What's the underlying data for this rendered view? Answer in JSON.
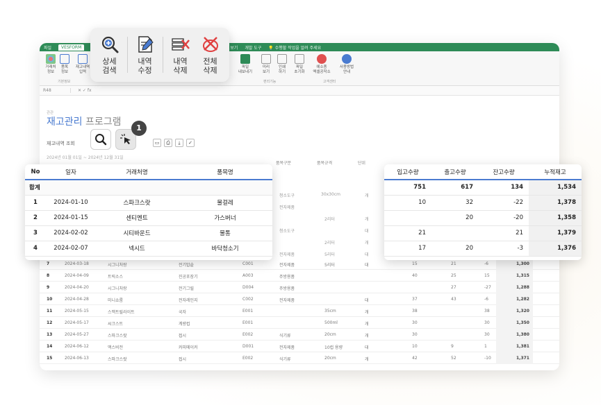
{
  "ribbon": {
    "tabs": [
      "파일",
      "VESFORM",
      "보기",
      "개발 도구",
      "수행할 작업을 알려 주세요"
    ],
    "buttons": [
      {
        "label": "거래처\n정보"
      },
      {
        "label": "품목\n정보"
      },
      {
        "label": "재고내역\n입력"
      },
      {
        "label": "파일\n내보내기"
      },
      {
        "label": "미리\n보기"
      },
      {
        "label": "인쇄\n하기"
      },
      {
        "label": "파일\n초기화"
      },
      {
        "label": "에소종\n엑셀공작소"
      },
      {
        "label": "사용방법\n안내"
      }
    ],
    "groups": [
      "기본정보",
      "편리기능",
      "고객센터"
    ]
  },
  "formula": {
    "cell_ref": "R48"
  },
  "toolbar": {
    "detail_search": "상세\n검색",
    "edit_record": "내역\n수정",
    "delete_record": "내역\n삭제",
    "delete_all": "전체\n삭제"
  },
  "program": {
    "breadcrumb": "관관",
    "title_a": "재고관리",
    "title_b": " 프로그램",
    "subtitle": "재고내역 조회",
    "date_range": "2024년 01월 01일 ~ 2024년 12월 31일"
  },
  "badge": "1",
  "left_table": {
    "headers": {
      "no": "No",
      "date": "일자",
      "vendor": "거래처명",
      "item": "품목명"
    },
    "total_label": "합계",
    "rows": [
      {
        "no": "1",
        "date": "2024-01-10",
        "vendor": "스파크스랏",
        "item": "물걸레"
      },
      {
        "no": "2",
        "date": "2024-01-15",
        "vendor": "센티멘트",
        "item": "가스버너"
      },
      {
        "no": "3",
        "date": "2024-02-02",
        "vendor": "시티바운드",
        "item": "물통"
      },
      {
        "no": "4",
        "date": "2024-02-07",
        "vendor": "넥시드",
        "item": "바닥청소기"
      }
    ]
  },
  "right_table": {
    "headers": {
      "in": "입고수량",
      "out": "출고수량",
      "remain": "잔고수량",
      "stock": "누적재고"
    },
    "total": {
      "in": "751",
      "out": "617",
      "remain": "134",
      "stock": "1,534"
    },
    "rows": [
      {
        "in": "10",
        "out": "32",
        "remain": "-22",
        "stock": "1,378"
      },
      {
        "in": "",
        "out": "20",
        "remain": "-20",
        "stock": "1,358"
      },
      {
        "in": "21",
        "out": "",
        "remain": "21",
        "stock": "1,379"
      },
      {
        "in": "17",
        "out": "20",
        "remain": "-3",
        "stock": "1,376"
      }
    ]
  },
  "bg_headers": {
    "category": "품목구분",
    "spec": "품목규격",
    "unit": "단위"
  },
  "bg_rows": [
    {
      "no": "7",
      "date": "2024-03-18",
      "vendor": "시그니처랑",
      "item": "전기밥솥",
      "code": "C001",
      "cat": "전자제품",
      "spec": "5리터",
      "unit": "대",
      "in": "15",
      "out": "21",
      "remain": "-6",
      "stock": "1,300"
    },
    {
      "no": "8",
      "date": "2024-04-09",
      "vendor": "트릭소스",
      "item": "진공포장기",
      "code": "A003",
      "cat": "주방용품",
      "spec": "",
      "unit": "",
      "in": "40",
      "out": "25",
      "remain": "15",
      "stock": "1,315"
    },
    {
      "no": "9",
      "date": "2024-04-20",
      "vendor": "시그니처랑",
      "item": "전기그릴",
      "code": "D004",
      "cat": "주방용품",
      "spec": "",
      "unit": "",
      "in": "",
      "out": "27",
      "remain": "-27",
      "stock": "1,288"
    },
    {
      "no": "10",
      "date": "2024-04-28",
      "vendor": "미니쇼룸",
      "item": "전자레인지",
      "code": "C002",
      "cat": "전자제품",
      "spec": "",
      "unit": "대",
      "in": "37",
      "out": "43",
      "remain": "-6",
      "stock": "1,282"
    },
    {
      "no": "11",
      "date": "2024-05-15",
      "vendor": "스맥트릴라이트",
      "item": "국자",
      "code": "E001",
      "cat": "",
      "spec": "35cm",
      "unit": "개",
      "in": "38",
      "out": "",
      "remain": "38",
      "stock": "1,320"
    },
    {
      "no": "12",
      "date": "2024-05-17",
      "vendor": "씨크스트",
      "item": "계량컵",
      "code": "E001",
      "cat": "",
      "spec": "500ml",
      "unit": "개",
      "in": "30",
      "out": "",
      "remain": "30",
      "stock": "1,350"
    },
    {
      "no": "13",
      "date": "2024-05-27",
      "vendor": "스파크스랏",
      "item": "접시",
      "code": "E002",
      "cat": "식기류",
      "spec": "20cm",
      "unit": "개",
      "in": "30",
      "out": "",
      "remain": "30",
      "stock": "1,380"
    },
    {
      "no": "14",
      "date": "2024-06-12",
      "vendor": "맥스비전",
      "item": "커피메이커",
      "code": "D001",
      "cat": "전자제품",
      "spec": "10컵 용량",
      "unit": "대",
      "in": "10",
      "out": "9",
      "remain": "1",
      "stock": "1,381"
    },
    {
      "no": "15",
      "date": "2024-06-13",
      "vendor": "스파크스랏",
      "item": "접시",
      "code": "E002",
      "cat": "식기류",
      "spec": "20cm",
      "unit": "개",
      "in": "42",
      "out": "52",
      "remain": "-10",
      "stock": "1,371"
    }
  ],
  "bg_fragments": {
    "cat1": "청소도구",
    "spec1": "30x30cm",
    "unit1": "개",
    "cat2": "전자제품",
    "spec3": "2리터",
    "unit3": "개",
    "cat4": "청소도구",
    "unit4": "대",
    "spec5": "2리터",
    "unit5": "개",
    "cat6": "전자제품",
    "spec6": "5리터",
    "unit6": "대"
  },
  "colors": {
    "ribbon": "#2e8b57",
    "accent": "#4a7bd0",
    "delete": "#e04040"
  }
}
